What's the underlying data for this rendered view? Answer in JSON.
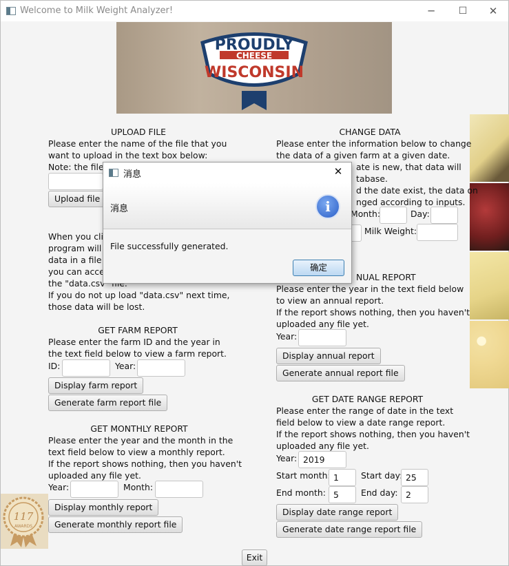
{
  "window": {
    "title": "Welcome to Milk Weight Analyzer!",
    "controls": {
      "minimize": "─",
      "maximize": "☐",
      "close": "✕"
    }
  },
  "logo": {
    "line1": "PROUDLY",
    "line2": "CHEESE",
    "line3": "WISCONSIN"
  },
  "upload": {
    "heading": "UPLOAD FILE",
    "lines": [
      "Please enter the name of the file that you",
      "want to upload in the text box below:",
      "Note: the file"
    ],
    "button": "Upload file",
    "file_value": "",
    "info_lines": [
      "When you cli",
      "program will a",
      "data in a file n",
      "you can acces",
      "the \"data.csv\" file.",
      "If you do not up load \"data.csv\" next time,",
      "those data will be lost."
    ]
  },
  "change": {
    "heading": "CHANGE DATA",
    "lines": [
      "Please enter the information below to change",
      "the data of a given farm at a given date.",
      "ate is new, that data will",
      "tabase.",
      "d the date exist, the data on",
      "nged according to inputs."
    ],
    "month_label": "Month:",
    "day_label": "Day:",
    "milk_weight_label": "Milk Weight:",
    "month_value": "",
    "day_value": "",
    "milk_weight_value": ""
  },
  "farm": {
    "heading": "GET FARM REPORT",
    "lines": [
      "Please enter the farm ID and the year in",
      "the text field below to view a farm report."
    ],
    "id_label": "ID:",
    "year_label": "Year:",
    "id_value": "",
    "year_value": "",
    "display_button": "Display farm report",
    "generate_button": "Generate farm report file"
  },
  "annual": {
    "heading": "NUAL REPORT",
    "lines": [
      "Please enter the year in the text field below",
      "to view an annual report.",
      "If the report shows nothing, then you haven't",
      "uploaded any file yet."
    ],
    "year_label": "Year:",
    "year_value": "",
    "display_button": "Display annual report",
    "generate_button": "Generate annual report file"
  },
  "monthly": {
    "heading": "GET MONTHLY REPORT",
    "lines": [
      "Please enter the year and the month in the",
      "text field below to view a monthly report.",
      "If the report shows nothing, then you haven't",
      "uploaded any file yet."
    ],
    "year_label": "Year:",
    "month_label": "Month:",
    "year_value": "",
    "month_value": "",
    "display_button": "Display monthly report",
    "generate_button": "Generate monthly report file"
  },
  "daterange": {
    "heading": "GET DATE RANGE REPORT",
    "lines": [
      "Please enter the range of date in the text",
      "field below to view a date range report.",
      "If the report shows nothing, then you haven't",
      "uploaded any file yet."
    ],
    "year_label": "Year:",
    "year_value": "2019",
    "start_month_label": "Start month:",
    "start_month_value": "1",
    "start_day_label": "Start day:",
    "start_day_value": "25",
    "end_month_label": "End month:",
    "end_month_value": "5",
    "end_day_label": "End day:",
    "end_day_value": "2",
    "display_button": "Display date range report",
    "generate_button": "Generate date range report file"
  },
  "badge": {
    "number": "117",
    "text": "AWARDS"
  },
  "exit_button": "Exit",
  "dialog": {
    "title": "消息",
    "header": "消息",
    "message": "File successfully generated.",
    "ok_button": "确定",
    "close": "✕",
    "info_icon": "i"
  },
  "colors": {
    "dialog_ok_border": "#3c7fb1",
    "info_icon": "#2b5fc8",
    "logo_navy": "#1d3f6e",
    "logo_red": "#c0392b"
  }
}
